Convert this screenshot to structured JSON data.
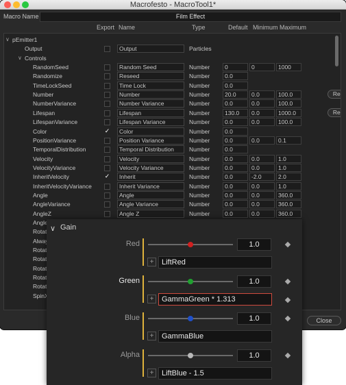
{
  "window": {
    "title": "Macrofesto - MacroTool1*"
  },
  "macro_name": {
    "label": "Macro Name",
    "value": "Film Effect"
  },
  "headers": {
    "export": "Export",
    "name": "Name",
    "type": "Type",
    "default": "Default",
    "minimum": "Minimum",
    "maximum": "Maximum"
  },
  "rows": [
    {
      "toggle": "∨",
      "name": "pEmitter1",
      "indent": 0
    },
    {
      "name": "Output",
      "indent": 1,
      "checked": false,
      "field": "Output",
      "type": "Particles"
    },
    {
      "toggle": "∨",
      "name": "Controls",
      "indent": 1
    },
    {
      "name": "RandomSeed",
      "indent": 2,
      "checked": false,
      "field": "Random Seed",
      "type": "Number",
      "default": "0",
      "min": "0",
      "max": "1000"
    },
    {
      "name": "Randomize",
      "indent": 2,
      "checked": false,
      "field": "Reseed",
      "type": "Number",
      "default": "0.0"
    },
    {
      "name": "TimeLockSeed",
      "indent": 2,
      "checked": false,
      "field": "Time Lock",
      "type": "Number",
      "default": "0.0"
    },
    {
      "name": "Number",
      "indent": 2,
      "checked": false,
      "field": "Number",
      "type": "Number",
      "default": "20.0",
      "min": "0.0",
      "max": "100.0",
      "reset": "Reset"
    },
    {
      "name": "NumberVariance",
      "indent": 2,
      "checked": false,
      "field": "Number Variance",
      "type": "Number",
      "default": "0.0",
      "min": "0.0",
      "max": "100.0"
    },
    {
      "name": "Lifespan",
      "indent": 2,
      "checked": false,
      "field": "Lifespan",
      "type": "Number",
      "default": "130.0",
      "min": "0.0",
      "max": "1000.0",
      "reset": "Reset"
    },
    {
      "name": "LifespanVariance",
      "indent": 2,
      "checked": false,
      "field": "Lifespan Variance",
      "type": "Number",
      "default": "0.0",
      "min": "0.0",
      "max": "100.0"
    },
    {
      "name": "Color",
      "indent": 2,
      "checked": true,
      "field": "Color",
      "type": "Number",
      "default": "0.0"
    },
    {
      "name": "PositionVariance",
      "indent": 2,
      "checked": false,
      "field": "Position Variance",
      "type": "Number",
      "default": "0.0",
      "min": "0.0",
      "max": "0.1"
    },
    {
      "name": "TemporalDistribution",
      "indent": 2,
      "checked": false,
      "field": "Temporal Distribution",
      "type": "Number",
      "default": "0.0"
    },
    {
      "name": "Velocity",
      "indent": 2,
      "checked": false,
      "field": "Velocity",
      "type": "Number",
      "default": "0.0",
      "min": "0.0",
      "max": "1.0"
    },
    {
      "name": "VelocityVariance",
      "indent": 2,
      "checked": false,
      "field": "Velocity Variance",
      "type": "Number",
      "default": "0.0",
      "min": "0.0",
      "max": "1.0"
    },
    {
      "name": "InheritVelocity",
      "indent": 2,
      "checked": true,
      "field": "Inherit",
      "type": "Number",
      "default": "0.0",
      "min": "-2.0",
      "max": "2.0"
    },
    {
      "name": "InheritVelocityVariance",
      "indent": 2,
      "checked": false,
      "field": "Inherit Variance",
      "type": "Number",
      "default": "0.0",
      "min": "0.0",
      "max": "1.0"
    },
    {
      "name": "Angle",
      "indent": 2,
      "checked": false,
      "field": "Angle",
      "type": "Number",
      "default": "0.0",
      "min": "0.0",
      "max": "360.0"
    },
    {
      "name": "AngleVariance",
      "indent": 2,
      "checked": false,
      "field": "Angle Variance",
      "type": "Number",
      "default": "0.0",
      "min": "0.0",
      "max": "360.0"
    },
    {
      "name": "AngleZ",
      "indent": 2,
      "checked": false,
      "field": "Angle Z",
      "type": "Number",
      "default": "0.0",
      "min": "0.0",
      "max": "360.0"
    },
    {
      "name": "Angle",
      "indent": 2
    },
    {
      "name": "Rotat",
      "indent": 2
    },
    {
      "name": "Alway",
      "indent": 2
    },
    {
      "name": "Rotat",
      "indent": 2
    },
    {
      "name": "Rotat",
      "indent": 2
    },
    {
      "name": "Rotat",
      "indent": 2
    },
    {
      "name": "Rotat",
      "indent": 2
    },
    {
      "name": "Rotat",
      "indent": 2
    },
    {
      "name": "SpinX",
      "indent": 2
    }
  ],
  "close_button": "Close",
  "gain_panel": {
    "toggle": "∨",
    "header": "Gain",
    "controls": [
      {
        "label": "Red",
        "value": "1.0",
        "expression": "LiftRed",
        "knob_color": "#d02020",
        "label_color": "#9a9a9a",
        "level": 0.5,
        "active": false
      },
      {
        "label": "Green",
        "value": "1.0",
        "expression": "GammaGreen * 1.313",
        "knob_color": "#20a030",
        "label_color": "#e8e8e8",
        "level": 0.5,
        "active": true
      },
      {
        "label": "Blue",
        "value": "1.0",
        "expression": "GammaBlue",
        "knob_color": "#2050c8",
        "label_color": "#9a9a9a",
        "level": 0.5,
        "active": false
      },
      {
        "label": "Alpha",
        "value": "1.0",
        "expression": "LiftBlue - 1.5",
        "knob_color": "#b8b8b8",
        "label_color": "#9a9a9a",
        "level": 0.5,
        "active": false
      }
    ]
  }
}
